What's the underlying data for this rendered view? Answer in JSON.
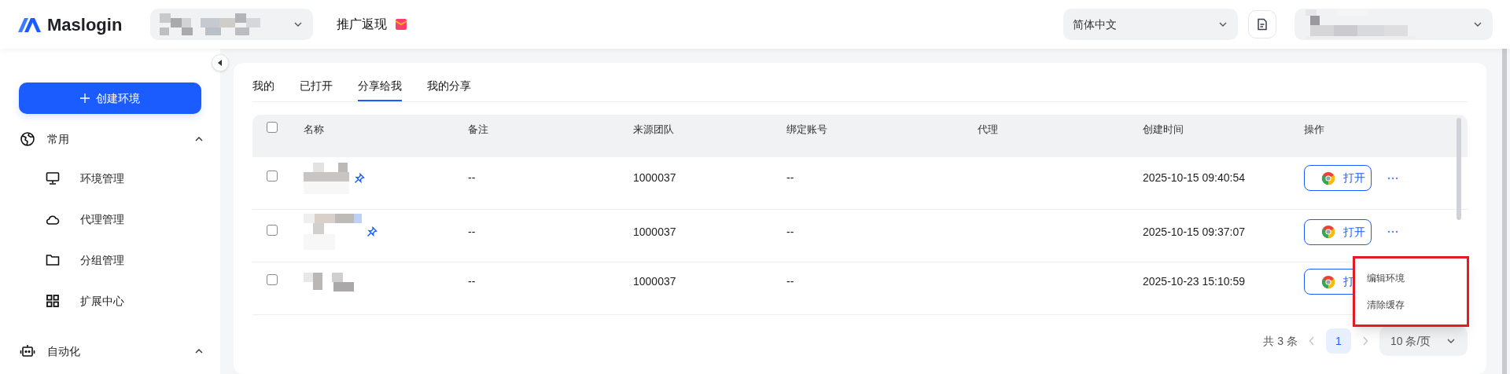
{
  "header": {
    "logo": "Maslogin",
    "promo": "推广返现",
    "language": "简体中文"
  },
  "sidebar": {
    "create_button": "创建环境",
    "groups": [
      {
        "label": "常用",
        "expanded": true,
        "children": [
          {
            "label": "环境管理"
          },
          {
            "label": "代理管理"
          },
          {
            "label": "分组管理"
          },
          {
            "label": "扩展中心"
          }
        ]
      },
      {
        "label": "自动化",
        "expanded": true
      }
    ]
  },
  "tabs": [
    {
      "label": "我的",
      "selected": false
    },
    {
      "label": "已打开",
      "selected": false
    },
    {
      "label": "分享给我",
      "selected": true
    },
    {
      "label": "我的分享",
      "selected": false
    }
  ],
  "table": {
    "select_all_checked": false,
    "columns": [
      "名称",
      "备注",
      "来源团队",
      "绑定账号",
      "代理",
      "创建时间",
      "操作"
    ],
    "rows": [
      {
        "checked": false,
        "pinned": true,
        "note": "--",
        "team": "1000037",
        "account": "--",
        "created": "2025-10-15 09:40:54",
        "action": "打开"
      },
      {
        "checked": false,
        "pinned": true,
        "note": "--",
        "team": "1000037",
        "account": "--",
        "created": "2025-10-15 09:37:07",
        "action": "打开"
      },
      {
        "checked": false,
        "pinned": false,
        "note": "--",
        "team": "1000037",
        "account": "--",
        "created": "2025-10-23 15:10:59",
        "action": "打"
      }
    ]
  },
  "row_menu": [
    "编辑环境",
    "清除缓存"
  ],
  "pagination": {
    "total": "共 3 条",
    "pages": [
      {
        "label": "1",
        "selected": true
      }
    ],
    "page_size": "10 条/页"
  }
}
